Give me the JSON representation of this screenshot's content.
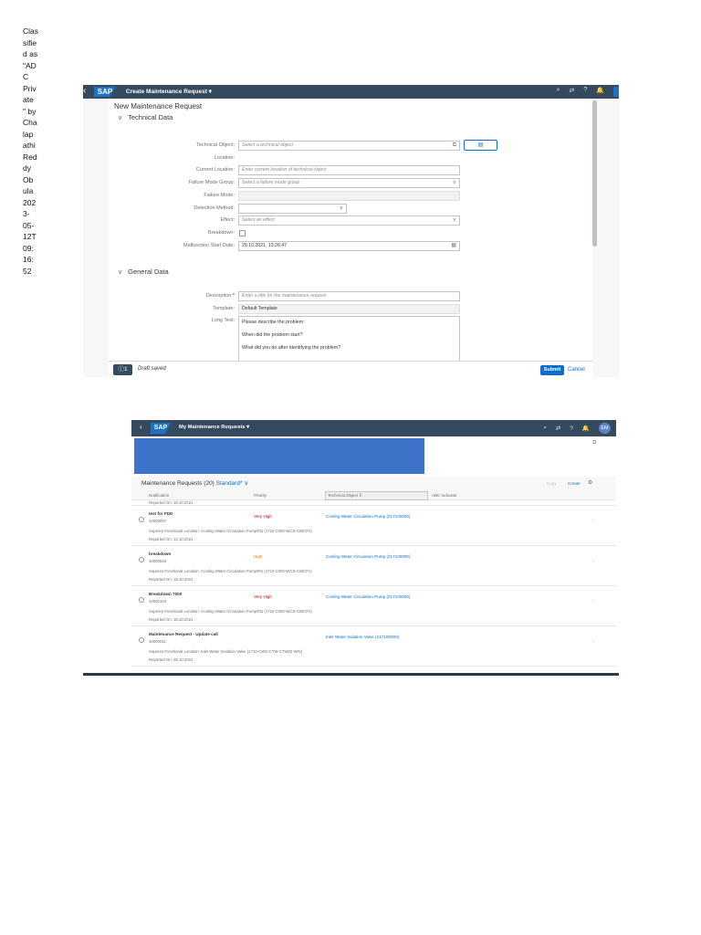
{
  "classification": [
    "Clas",
    "sifie",
    "d as",
    "\"AD",
    "C",
    "Priv",
    "ate",
    "\" by",
    "Cha",
    "lap",
    "athi",
    "Red",
    "dy",
    "Ob",
    "ula",
    "202",
    "3-",
    "05-",
    "12T",
    "09:",
    "16:",
    "52"
  ],
  "shot1": {
    "shell": {
      "back": "‹",
      "logo": "SAP",
      "title": "Create Maintenance Request ▾",
      "icons": [
        "⌕",
        "⇄",
        "?",
        "🔔"
      ]
    },
    "page_title": "New Maintenance Request",
    "technical_section": {
      "title": "Technical Data",
      "fields": {
        "technical_object": {
          "label": "Technical Object:",
          "placeholder": "Select a technical object",
          "button": "▤"
        },
        "location": {
          "label": "Location:"
        },
        "current_location": {
          "label": "Current Location:",
          "placeholder": "Enter current location of technical object"
        },
        "failure_mode_group": {
          "label": "Failure Mode Group:",
          "placeholder": "Select a failure mode group"
        },
        "failure_mode": {
          "label": "Failure Mode:"
        },
        "detection_method": {
          "label": "Detection Method:"
        },
        "effect": {
          "label": "Effect:",
          "placeholder": "Select an effect"
        },
        "breakdown": {
          "label": "Breakdown:",
          "checked": false
        },
        "malfunction_start": {
          "label": "Malfunction Start Date:",
          "value": "29.10.2021, 13:26:47"
        }
      }
    },
    "general_section": {
      "title": "General Data",
      "fields": {
        "description": {
          "label": "Description:",
          "required_mark": "*",
          "placeholder": "Enter a title for the maintenance request"
        },
        "template": {
          "label": "Template:",
          "value": "Default Template"
        },
        "long_text": {
          "label": "Long Text:",
          "lines": [
            "Please describe the problem:",
            "When did the problem start?",
            "What did you do after identifying the problem?"
          ]
        }
      }
    },
    "footer": {
      "message_count": "ⓘ1",
      "status": "Draft saved",
      "submit": "Submit",
      "cancel": "Cancel"
    }
  },
  "shot2": {
    "shell": {
      "back": "‹",
      "logo": "SAP",
      "title": "My Maintenance Requests ▾",
      "icons": [
        "⌕",
        "⇄",
        "?",
        "🔔"
      ],
      "avatar": "EM"
    },
    "list_title": "Maintenance Requests (20)",
    "variant": "Standard* ∨",
    "toolbar": {
      "copy": "Copy",
      "create": "Create",
      "settings": "⚙"
    },
    "columns": {
      "notification": "Notification",
      "priority": "Priority",
      "technical_object": "Technical Object",
      "abc": "ABC Indicator"
    },
    "partial_row": "Reported On: 18.10.2021",
    "rows": [
      {
        "title": "test for FDD",
        "id": "10000007",
        "priority": "Very High",
        "priority_color": "#bb0000",
        "technical_object": "Cooling Water Circulation Pump (217100000)",
        "superior": "Superior Functional Location: Cooling Water Circulation Pump#01 (1710-CWS-WCS-CWCP1)",
        "reported": "Reported On: 12.10.2021"
      },
      {
        "title": "breakdown",
        "id": "10000918",
        "priority": "High",
        "priority_color": "#e9730c",
        "technical_object": "Cooling Water Circulation Pump (217100000)",
        "superior": "Superior Functional Location: Cooling Water Circulation Pump#01 (1710-CWS-WCS-CWCP1)",
        "reported": "Reported On: 18.10.2021"
      },
      {
        "title": "Breakdown 7000",
        "id": "10000104",
        "priority": "Very High",
        "priority_color": "#bb0000",
        "technical_object": "Cooling Water Circulation Pump (217100000)",
        "superior": "Superior Functional Location: Cooling Water Circulation Pump#01 (1710-CWS-WCS-CWCP1)",
        "reported": "Reported On: 18.10.2021"
      },
      {
        "title": "Maintenance Request - Update call",
        "id": "10000011",
        "priority": "",
        "priority_color": "#32363a",
        "technical_object": "Inlet Water Isolation Valve (217100000)",
        "superior": "Superior Functional Location: Inlet Water Isolation Valve (1710-CWS-CTW-CTW02-WIV)",
        "reported": "Reported On: 08.10.2021"
      }
    ]
  }
}
